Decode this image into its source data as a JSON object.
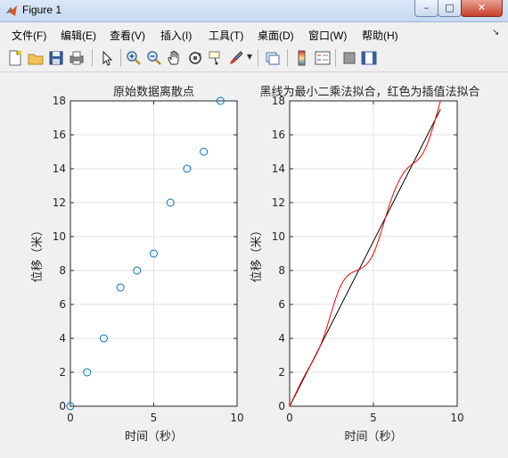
{
  "window": {
    "title": "Figure 1",
    "controls": {
      "minimize": "–",
      "maximize": "□",
      "close": "✕"
    }
  },
  "menubar": {
    "items": [
      "文件(F)",
      "编辑(E)",
      "查看(V)",
      "插入(I)",
      "工具(T)",
      "桌面(D)",
      "窗口(W)",
      "帮助(H)"
    ]
  },
  "toolbar": {
    "icons": [
      "new-figure-icon",
      "open-file-icon",
      "save-icon",
      "print-icon",
      "pointer-icon",
      "zoom-in-icon",
      "zoom-out-icon",
      "pan-hand-icon",
      "rotate-3d-icon",
      "data-cursor-icon",
      "brush-icon",
      "link-plot-icon",
      "colorbar-icon",
      "legend-icon",
      "hide-plot-tools-icon",
      "show-plot-tools-icon"
    ]
  },
  "chart_data": [
    {
      "type": "scatter",
      "title": "原始数据离散点",
      "xlabel": "时间（秒）",
      "ylabel": "位移（米）",
      "xlim": [
        0,
        10
      ],
      "ylim": [
        0,
        18
      ],
      "xticks": [
        0,
        5,
        10
      ],
      "yticks": [
        0,
        2,
        4,
        6,
        8,
        10,
        12,
        14,
        16,
        18
      ],
      "grid": true,
      "series": [
        {
          "x": [
            0,
            1,
            2,
            3,
            4,
            5,
            6,
            7,
            8,
            9
          ],
          "y": [
            0,
            2,
            4,
            7,
            8,
            9,
            12,
            14,
            15,
            18
          ],
          "marker": "o",
          "color": "#0072bd"
        }
      ]
    },
    {
      "type": "line",
      "title": "黑线为最小二乘法拟合，红色为插值法拟合",
      "xlabel": "时间（秒）",
      "ylabel": "位移（米）",
      "xlim": [
        0,
        10
      ],
      "ylim": [
        0,
        18
      ],
      "xticks": [
        0,
        5,
        10
      ],
      "yticks": [
        0,
        2,
        4,
        6,
        8,
        10,
        12,
        14,
        16,
        18
      ],
      "grid": true,
      "series": [
        {
          "kind": "least-squares",
          "color": "#000000",
          "x": [
            0,
            9
          ],
          "y": [
            0,
            17.5
          ]
        },
        {
          "kind": "interpolation",
          "color": "#ff0000",
          "x": [
            0,
            1,
            2,
            3,
            4,
            5,
            6,
            7,
            8,
            9
          ],
          "y": [
            0,
            2,
            4,
            7,
            8,
            9,
            12,
            14,
            15,
            18
          ]
        }
      ]
    }
  ]
}
